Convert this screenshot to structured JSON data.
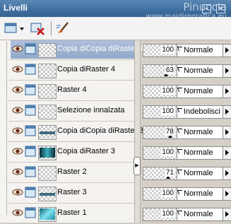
{
  "panel": {
    "title": "Livelli",
    "watermark_line1": "Pinuccia",
    "watermark_line2": "www.maidiregrafica.eu"
  },
  "colors": {
    "titlebar": "#3f6e9f",
    "selection": "#9eb3d2",
    "panel_bg": "#d4d0c8"
  },
  "toolbar": {
    "buttons": [
      {
        "icon": "new-layer-dropdown-icon"
      },
      {
        "icon": "delete-layer-icon"
      },
      {
        "icon": "edit-layer-icon"
      }
    ]
  },
  "layers": [
    {
      "name": "Copia diCopia diRaster 4",
      "opacity": "100",
      "blend": "Normale",
      "selected": true,
      "thumb": "checker"
    },
    {
      "name": "Copia diRaster 4",
      "opacity": "63",
      "blend": "Normale",
      "selected": false,
      "thumb": "checker"
    },
    {
      "name": "Raster 4",
      "opacity": "100",
      "blend": "Normale",
      "selected": false,
      "thumb": "checker"
    },
    {
      "name": "Selezione innalzata",
      "opacity": "100",
      "blend": "Indebolisci",
      "selected": false,
      "thumb": "checker"
    },
    {
      "name": "Copia diCopia diRaster 3",
      "opacity": "78",
      "blend": "Normale",
      "selected": false,
      "thumb": "strip"
    },
    {
      "name": "Copia diRaster 3",
      "opacity": "100",
      "blend": "Normale",
      "selected": false,
      "thumb": "teal"
    },
    {
      "name": "Raster 2",
      "opacity": "71",
      "blend": "Normale",
      "selected": false,
      "thumb": "checker"
    },
    {
      "name": "Raster 3",
      "opacity": "100",
      "blend": "Normale",
      "selected": false,
      "thumb": "strip"
    },
    {
      "name": "Raster 1",
      "opacity": "100",
      "blend": "Normale",
      "selected": false,
      "thumb": "bright"
    }
  ]
}
